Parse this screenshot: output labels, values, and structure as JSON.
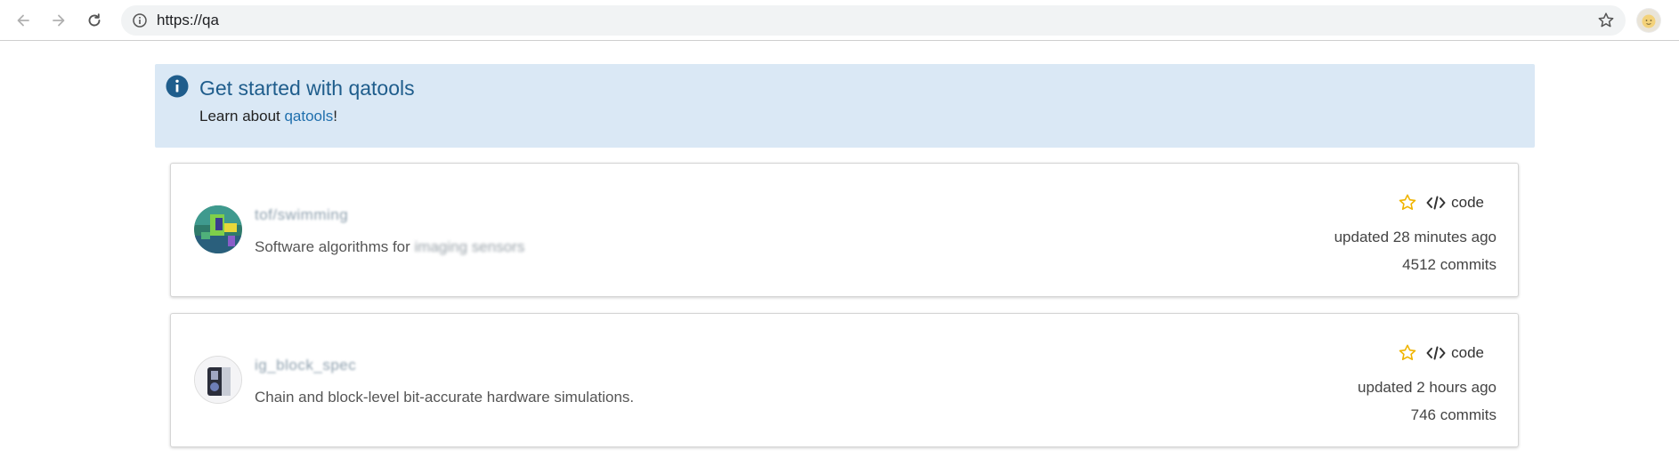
{
  "browser": {
    "url": "https://qa"
  },
  "banner": {
    "title": "Get started with qatools",
    "desc_prefix": "Learn about ",
    "desc_link": "qatools",
    "desc_suffix": "!"
  },
  "projects": [
    {
      "name": "tof/swimming",
      "description": "Software algorithms for",
      "description_blurred": "imaging sensors",
      "star_label": "",
      "code_label": "code",
      "updated": "updated 28 minutes ago",
      "commits": "4512 commits"
    },
    {
      "name": "ig_block_spec",
      "description": "Chain and block-level bit-accurate hardware simulations.",
      "description_blurred": "",
      "star_label": "",
      "code_label": "code",
      "updated": "updated 2 hours ago",
      "commits": "746 commits"
    }
  ],
  "colors": {
    "banner_bg": "#dae8f5",
    "banner_title": "#1f5d8c",
    "link": "#1f6fad",
    "star": "#f0b400"
  },
  "icons": [
    "back-icon",
    "forward-icon",
    "reload-icon",
    "info-icon",
    "bookmark-star-icon",
    "profile-icon",
    "star-icon",
    "code-icon"
  ]
}
